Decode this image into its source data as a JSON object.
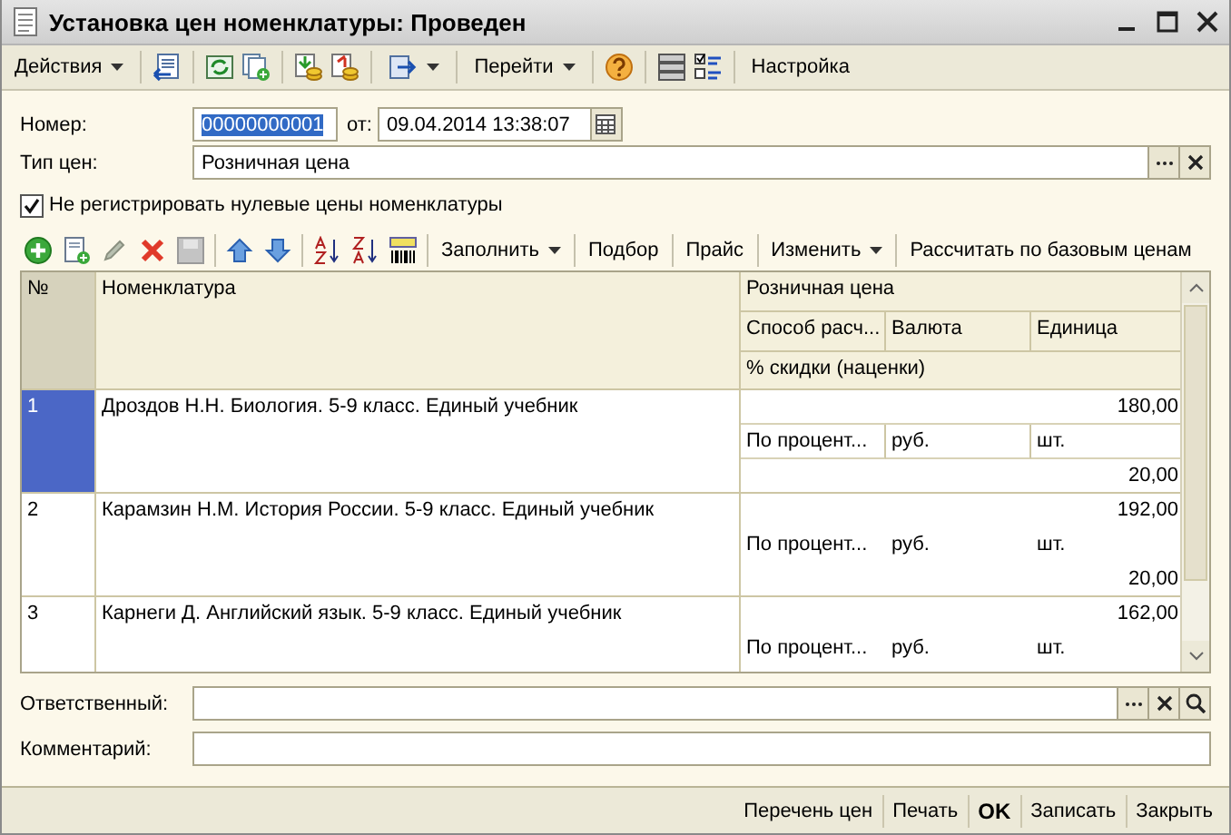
{
  "window": {
    "title": "Установка цен номенклатуры: Проведен"
  },
  "toolbar": [
    {
      "label": "Действия",
      "dropdown": true
    },
    {
      "label": "Перейти",
      "dropdown": true
    },
    {
      "label": "Настройка",
      "dropdown": false
    }
  ],
  "number": {
    "label": "Номер:",
    "value": "00000000001",
    "highlighted": true,
    "date_label": "от:",
    "date_value": "09.04.2014 13:38:07"
  },
  "price_type": {
    "label": "Тип цен:",
    "value": "Розничная цена"
  },
  "checkbox": {
    "label": "Не регистрировать нулевые цены номенклатуры",
    "checked": true
  },
  "table_toolbar": [
    {
      "label": "Заполнить",
      "dropdown": true
    },
    {
      "label": "Подбор",
      "dropdown": false
    },
    {
      "label": "Прайс",
      "dropdown": false
    },
    {
      "label": "Изменить",
      "dropdown": true
    },
    {
      "label": "Рассчитать по базовым ценам",
      "dropdown": false
    }
  ],
  "table": {
    "columns": {
      "number": "№",
      "item": "Номенклатура",
      "group": "Розничная цена",
      "method": "Способ расч...",
      "currency": "Валюта",
      "unit": "Единица",
      "discount": "% скидки (наценки)"
    },
    "rows": [
      {
        "number": "1",
        "item": "Дроздов Н.Н. Биология. 5-9 класс. Единый учебник",
        "price": "180,00",
        "method": "По процент...",
        "currency": "руб.",
        "unit": "шт.",
        "discount": "20,00",
        "selected": true
      },
      {
        "number": "2",
        "item": "Карамзин Н.М. История России. 5-9 класс. Единый учебник",
        "price": "192,00",
        "method": "По процент...",
        "currency": "руб.",
        "unit": "шт.",
        "discount": "20,00",
        "selected": false
      },
      {
        "number": "3",
        "item": "Карнеги Д. Английский язык. 5-9 класс. Единый учебник",
        "price": "162,00",
        "method": "По процент...",
        "currency": "руб.",
        "unit": "шт.",
        "selected": false
      }
    ]
  },
  "responsible": {
    "label": "Ответственный:"
  },
  "comment": {
    "label": "Комментарий:"
  },
  "bottom_buttons": [
    {
      "label": "Перечень цен",
      "default": false
    },
    {
      "label": "Печать",
      "default": false
    },
    {
      "label": "OK",
      "default": true
    },
    {
      "label": "Записать",
      "default": false
    },
    {
      "label": "Закрыть",
      "default": false
    }
  ]
}
